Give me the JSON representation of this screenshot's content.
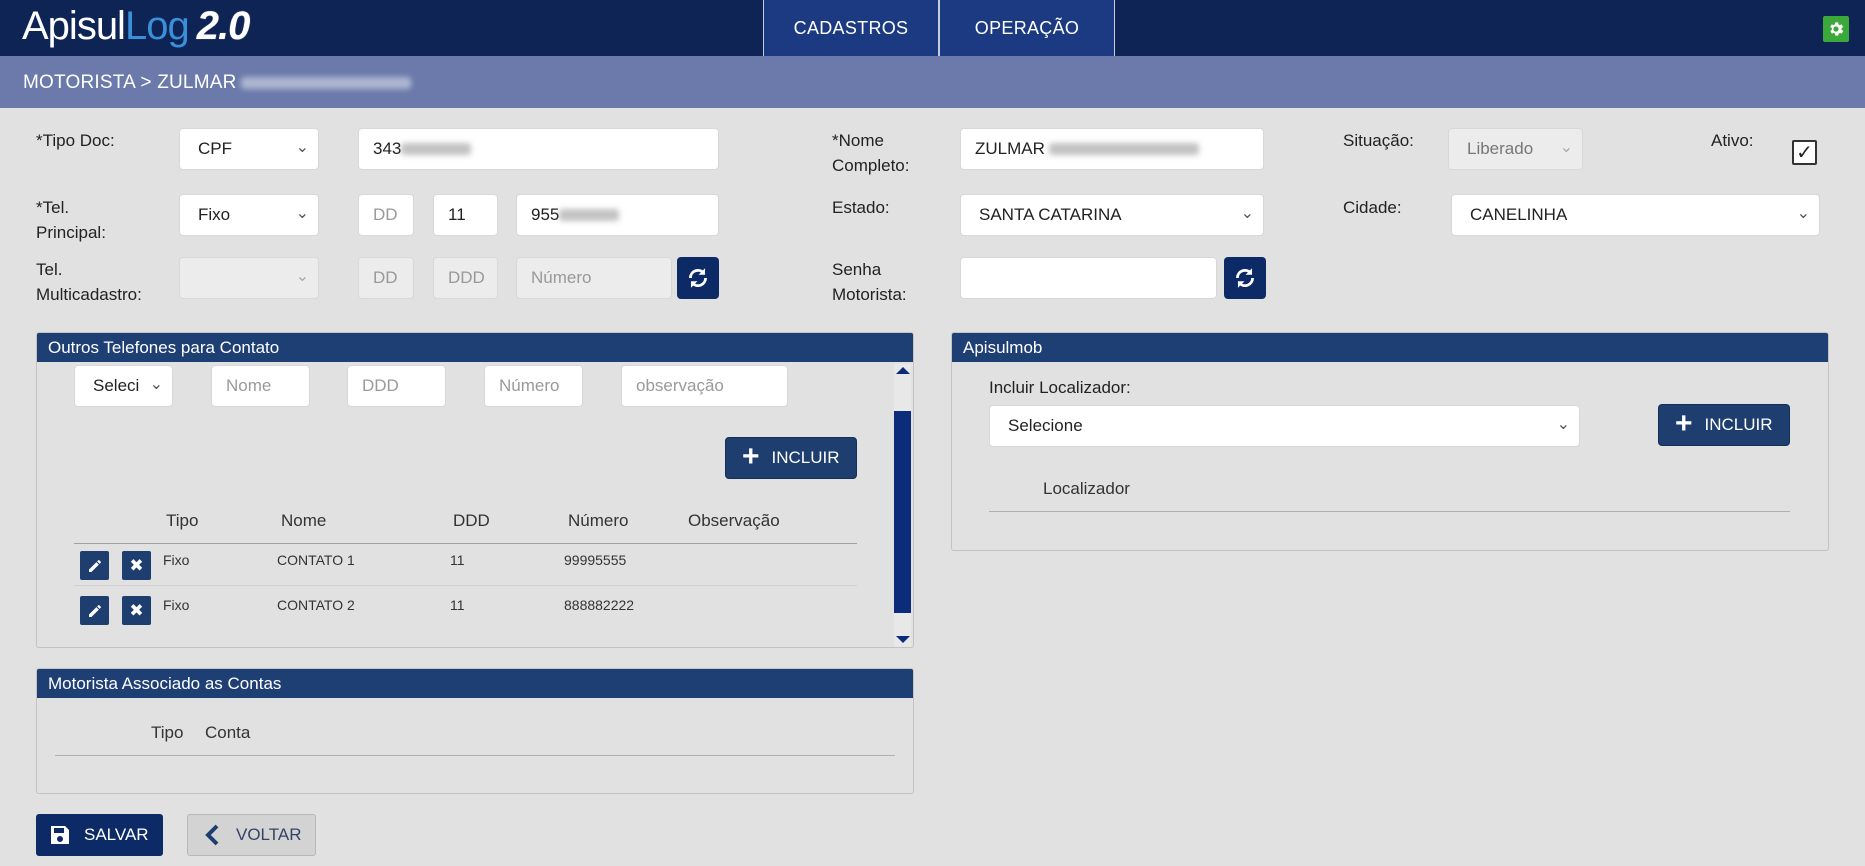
{
  "app": {
    "logo_main": "Apisul",
    "logo_accent": "Log",
    "logo_version": "2.0"
  },
  "nav": {
    "tabs": [
      {
        "label": "CADASTROS"
      },
      {
        "label": "OPERAÇÃO"
      }
    ]
  },
  "breadcrumb": {
    "text": "MOTORISTA > ZULMAR"
  },
  "form": {
    "tipo_doc": {
      "label": "*Tipo Doc:",
      "value": "CPF"
    },
    "documento": {
      "value": "343"
    },
    "nome_completo": {
      "label_line1": "*Nome",
      "label_line2": "Completo:",
      "value": "ZULMAR"
    },
    "situacao": {
      "label": "Situação:",
      "value": "Liberado"
    },
    "ativo": {
      "label": "Ativo:",
      "checked": true,
      "check_glyph": "✓"
    },
    "tel_principal": {
      "label_line1": "*Tel.",
      "label_line2": "Principal:",
      "tipo": "Fixo",
      "dd_placeholder": "DD",
      "ddd": "11",
      "numero": "955"
    },
    "estado": {
      "label": "Estado:",
      "value": "SANTA CATARINA"
    },
    "cidade": {
      "label": "Cidade:",
      "value": "CANELINHA"
    },
    "tel_multicadastro": {
      "label_line1": "Tel.",
      "label_line2": "Multicadastro:",
      "dd_placeholder": "DD",
      "ddd_placeholder": "DDD",
      "numero_placeholder": "Número"
    },
    "senha_motorista": {
      "label_line1": "Senha",
      "label_line2": "Motorista:",
      "value": ""
    }
  },
  "outros_telefones": {
    "title": "Outros Telefones para Contato",
    "inputs": {
      "tipo_select": "Seleci",
      "nome_placeholder": "Nome",
      "ddd_placeholder": "DDD",
      "numero_placeholder": "Número",
      "observacao_placeholder": "observação"
    },
    "incluir_label": "INCLUIR",
    "columns": [
      "Tipo",
      "Nome",
      "DDD",
      "Número",
      "Observação"
    ],
    "rows": [
      {
        "tipo": "Fixo",
        "nome": "CONTATO 1",
        "ddd": "11",
        "numero": "99995555",
        "observacao": ""
      },
      {
        "tipo": "Fixo",
        "nome": "CONTATO 2",
        "ddd": "11",
        "numero": "888882222",
        "observacao": ""
      }
    ]
  },
  "apisulmob": {
    "title": "Apisulmob",
    "incluir_localizador_label": "Incluir Localizador:",
    "select_value": "Selecione",
    "incluir_label": "INCLUIR",
    "column": "Localizador"
  },
  "motorista_contas": {
    "title": "Motorista Associado as Contas",
    "columns": [
      "Tipo",
      "Conta"
    ]
  },
  "footer": {
    "save_label": "SALVAR",
    "back_label": "VOLTAR"
  },
  "colors": {
    "topbar": "#0d2454",
    "nav_tab": "#1c3a82",
    "breadcrumb_bar": "#6b7aab",
    "panel_header": "#1e3f73",
    "settings_green": "#3aa93a"
  },
  "icons": {
    "settings": "gear-icon",
    "refresh": "refresh-icon",
    "edit": "pencil-icon",
    "delete": "close-icon",
    "save": "floppy-icon",
    "back": "chevron-left-icon",
    "add": "plus-icon"
  }
}
